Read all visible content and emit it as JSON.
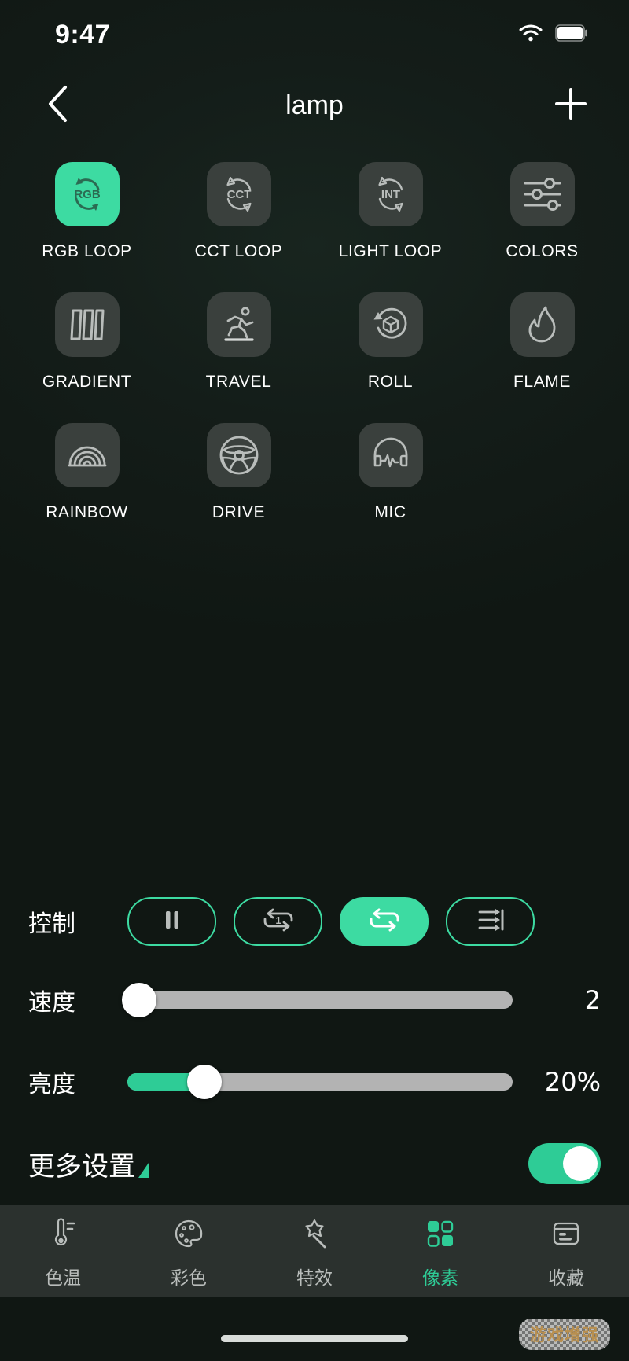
{
  "status_bar": {
    "time": "9:47",
    "wifi_icon": "wifi-icon",
    "battery_icon": "battery-full-icon"
  },
  "nav": {
    "back_icon": "chevron-left-icon",
    "title": "lamp",
    "add_icon": "plus-icon"
  },
  "effects": {
    "items": [
      {
        "label": "RGB LOOP",
        "icon": "rgb-loop-icon",
        "icon_text": "RGB",
        "selected": true
      },
      {
        "label": "CCT LOOP",
        "icon": "cct-loop-icon",
        "icon_text": "CCT",
        "selected": false
      },
      {
        "label": "LIGHT LOOP",
        "icon": "int-loop-icon",
        "icon_text": "INT",
        "selected": false
      },
      {
        "label": "COLORS",
        "icon": "sliders-icon",
        "icon_text": "",
        "selected": false
      },
      {
        "label": "GRADIENT",
        "icon": "bars-icon",
        "icon_text": "",
        "selected": false
      },
      {
        "label": "TRAVEL",
        "icon": "runner-icon",
        "icon_text": "",
        "selected": false
      },
      {
        "label": "ROLL",
        "icon": "cube-rotate-icon",
        "icon_text": "",
        "selected": false
      },
      {
        "label": "FLAME",
        "icon": "flame-icon",
        "icon_text": "",
        "selected": false
      },
      {
        "label": "RAINBOW",
        "icon": "rainbow-icon",
        "icon_text": "",
        "selected": false
      },
      {
        "label": "DRIVE",
        "icon": "steering-wheel-icon",
        "icon_text": "",
        "selected": false
      },
      {
        "label": "MIC",
        "icon": "headphone-wave-icon",
        "icon_text": "",
        "selected": false
      }
    ]
  },
  "controls": {
    "label": "控制",
    "buttons": [
      {
        "name": "pause",
        "icon": "pause-icon",
        "active": false
      },
      {
        "name": "repeat-one",
        "icon": "repeat-one-icon",
        "active": false
      },
      {
        "name": "repeat-all",
        "icon": "repeat-icon",
        "active": true
      },
      {
        "name": "play-to-end",
        "icon": "play-to-end-icon",
        "active": false
      }
    ]
  },
  "sliders": {
    "speed": {
      "label": "速度",
      "value": "2",
      "percent": 3
    },
    "brightness": {
      "label": "亮度",
      "value": "20%",
      "percent": 20
    }
  },
  "more_settings": {
    "label": "更多设置",
    "caret_icon": "triangle-expand-icon",
    "toggle_on": true
  },
  "tabbar": {
    "items": [
      {
        "label": "色温",
        "icon": "thermometer-icon",
        "active": false
      },
      {
        "label": "彩色",
        "icon": "palette-icon",
        "active": false
      },
      {
        "label": "特效",
        "icon": "magic-wand-icon",
        "active": false
      },
      {
        "label": "像素",
        "icon": "pixel-grid-icon",
        "active": true
      },
      {
        "label": "收藏",
        "icon": "card-save-icon",
        "active": false
      }
    ]
  },
  "footer": {
    "watermark": "游戏增强",
    "home_indicator": "home-indicator"
  },
  "colors": {
    "accent": "#3ddba2",
    "accent_fill": "#2ecc96",
    "background": "#101713",
    "tile": "#3a403d",
    "tabbar": "#2b312e",
    "track": "#b3b3b3"
  }
}
